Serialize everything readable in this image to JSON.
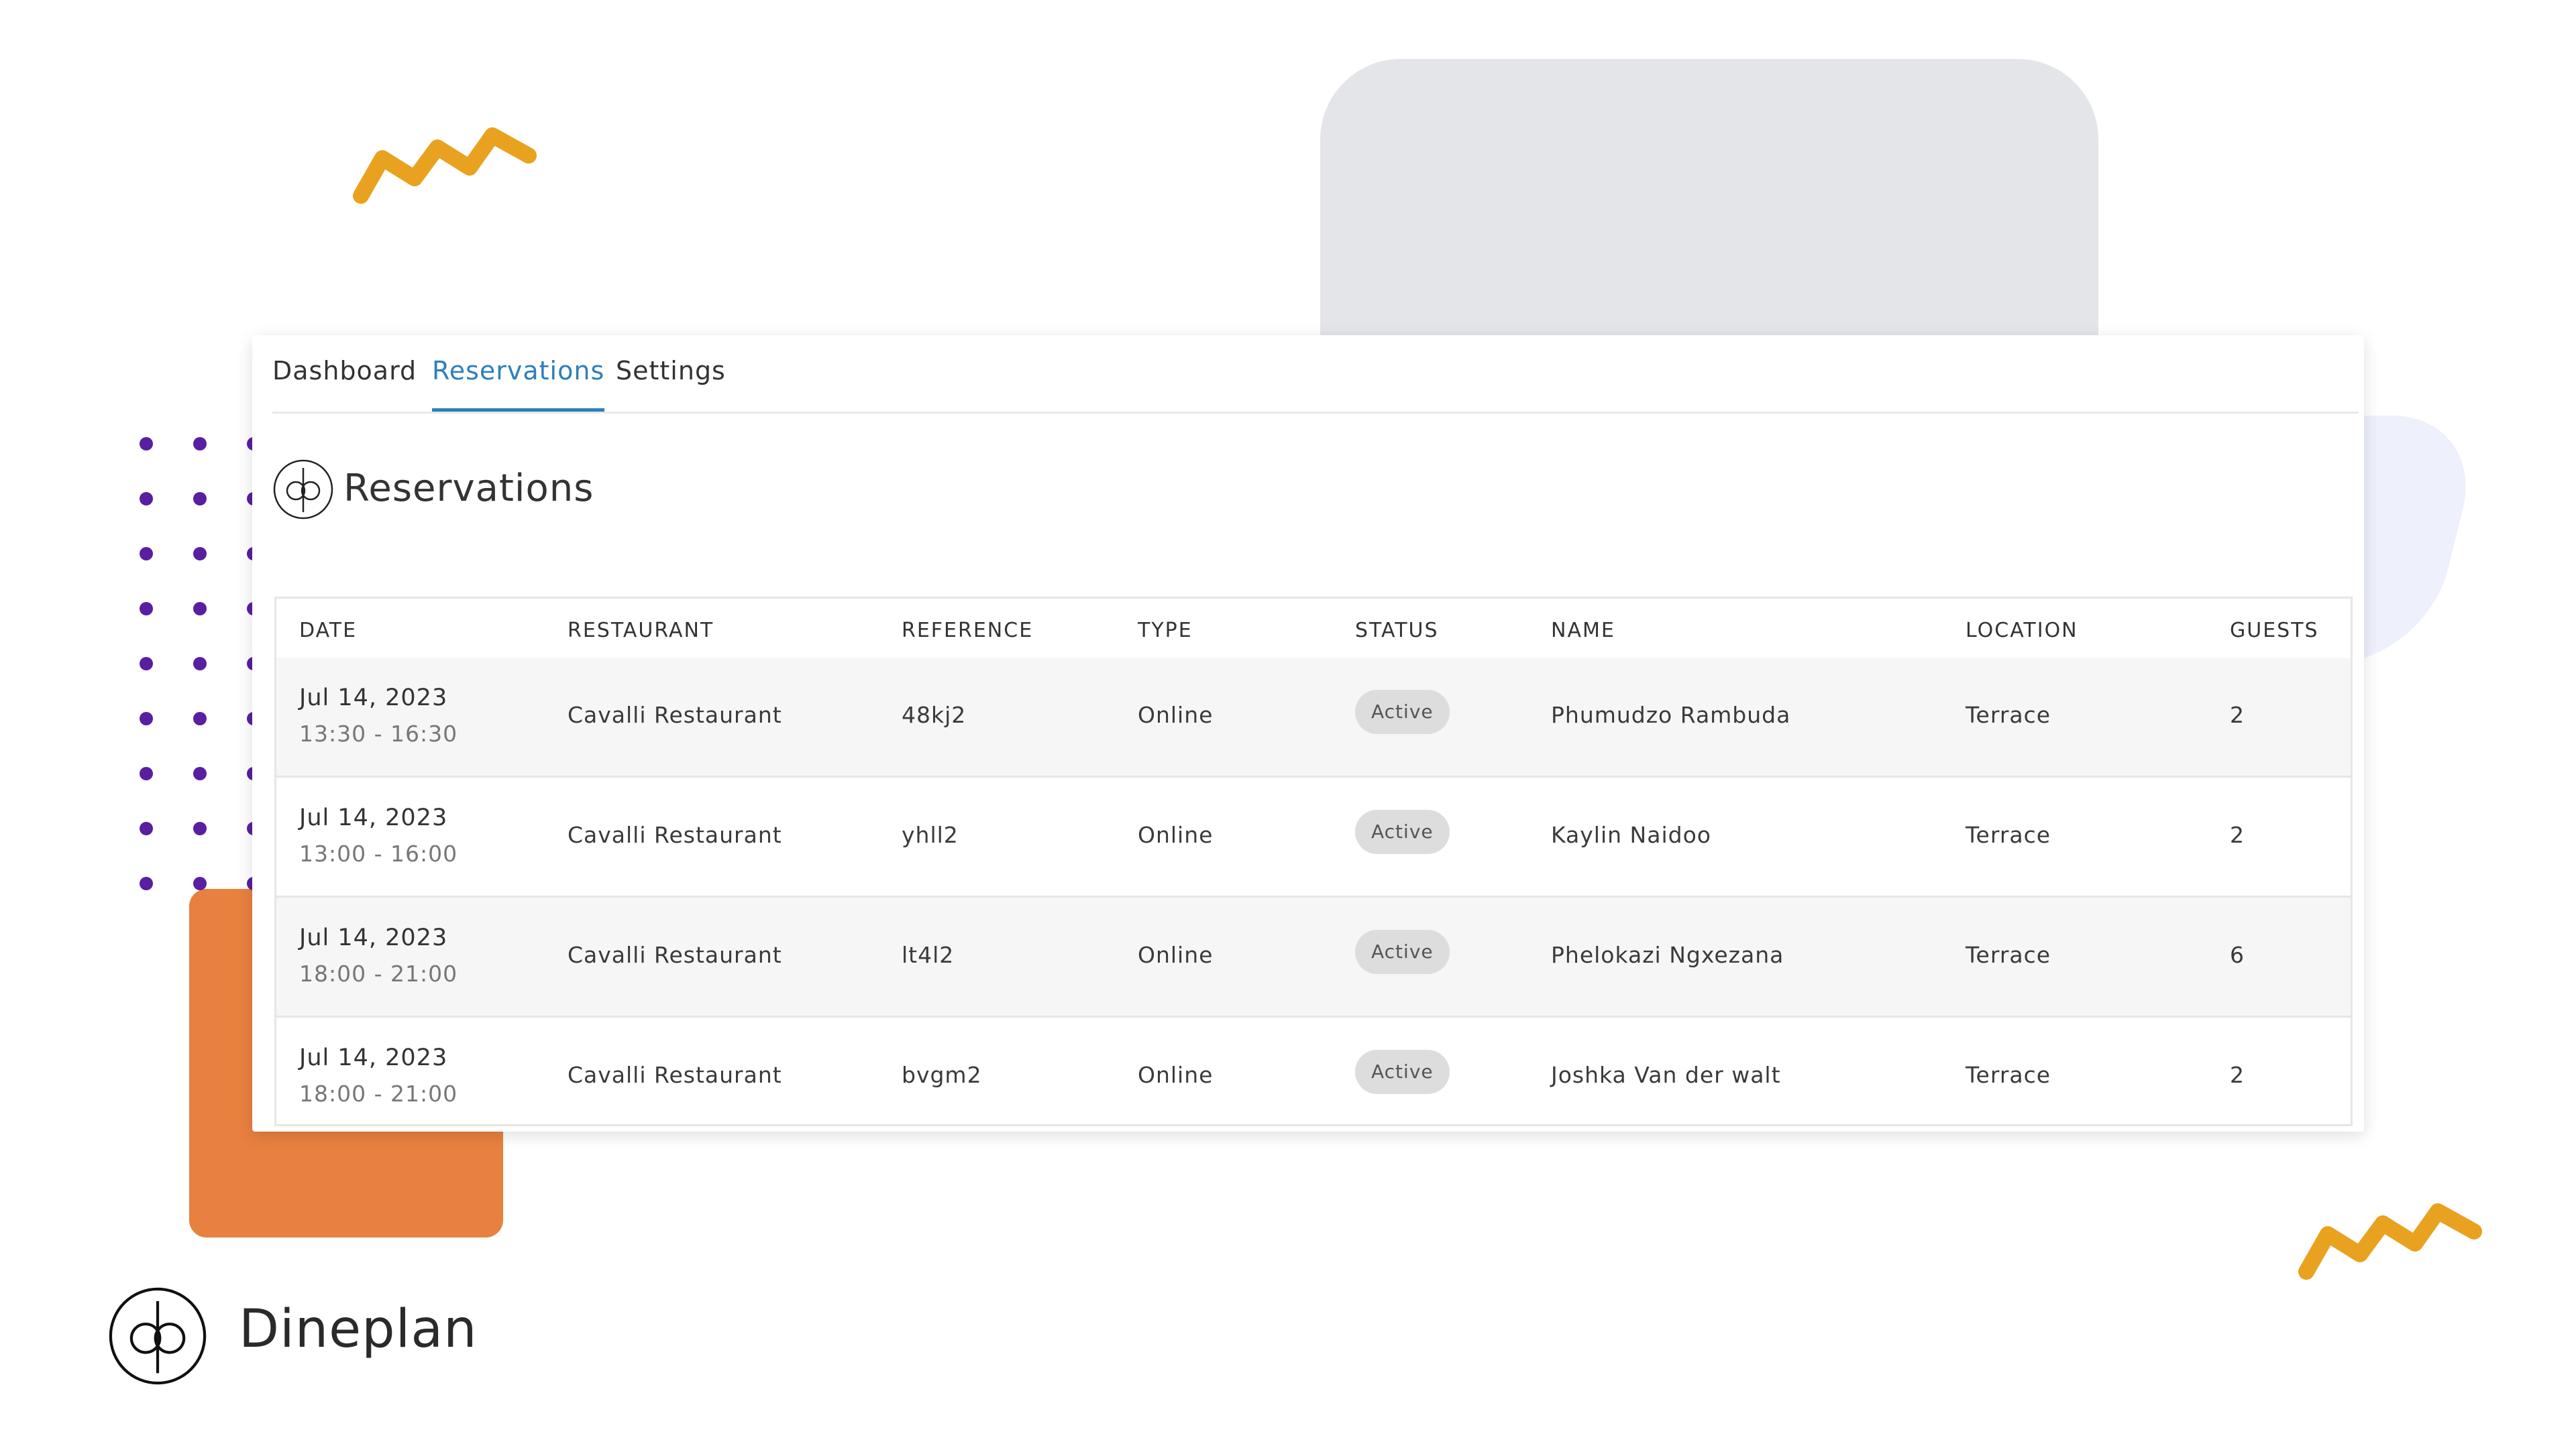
{
  "tabs": [
    {
      "label": "Dashboard",
      "active": false
    },
    {
      "label": "Reservations",
      "active": true
    },
    {
      "label": "Settings",
      "active": false
    }
  ],
  "page": {
    "title": "Reservations",
    "logo_icon": "dp-monogram-icon"
  },
  "table": {
    "columns": [
      "DATE",
      "RESTAURANT",
      "REFERENCE",
      "TYPE",
      "STATUS",
      "NAME",
      "LOCATION",
      "GUESTS"
    ],
    "rows": [
      {
        "date": "Jul 14, 2023",
        "time": "13:30 - 16:30",
        "restaurant": "Cavalli Restaurant",
        "reference": "48kj2",
        "type": "Online",
        "status": "Active",
        "name": "Phumudzo Rambuda",
        "location": "Terrace",
        "guests": "2"
      },
      {
        "date": "Jul 14, 2023",
        "time": "13:00 - 16:00",
        "restaurant": "Cavalli Restaurant",
        "reference": "yhll2",
        "type": "Online",
        "status": "Active",
        "name": "Kaylin Naidoo",
        "location": "Terrace",
        "guests": "2"
      },
      {
        "date": "Jul 14, 2023",
        "time": "18:00 - 21:00",
        "restaurant": "Cavalli Restaurant",
        "reference": "lt4l2",
        "type": "Online",
        "status": "Active",
        "name": "Phelokazi Ngxezana",
        "location": "Terrace",
        "guests": "6"
      },
      {
        "date": "Jul 14, 2023",
        "time": "18:00 - 21:00",
        "restaurant": "Cavalli Restaurant",
        "reference": "bvgm2",
        "type": "Online",
        "status": "Active",
        "name": "Joshka Van der walt",
        "location": "Terrace",
        "guests": "2"
      }
    ]
  },
  "brand": {
    "name": "Dineplan",
    "logo_icon": "dp-monogram-icon"
  },
  "colors": {
    "accent": "#2d7fbb",
    "orange": "#e8803f",
    "purple_dots": "#5a1ea0",
    "zigzag": "#e9a21f",
    "badge_bg": "#dddddd"
  }
}
